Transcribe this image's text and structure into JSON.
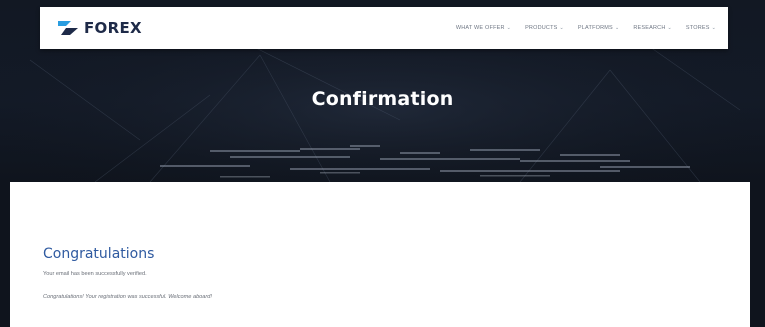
{
  "brand": {
    "name": "FOREX",
    "accent_color": "#2a9de0",
    "text_color": "#1e2a48"
  },
  "nav": {
    "items": [
      {
        "label": "WHAT WE OFFER",
        "icon": "chevron-down-icon"
      },
      {
        "label": "PRODUCTS",
        "icon": "chevron-down-icon"
      },
      {
        "label": "PLATFORMS",
        "icon": "chevron-down-icon"
      },
      {
        "label": "RESEARCH",
        "icon": "chevron-down-icon"
      },
      {
        "label": "STORES",
        "icon": "chevron-down-icon"
      }
    ]
  },
  "hero": {
    "title": "Confirmation"
  },
  "content": {
    "heading": "Congratulations",
    "line1": "Your email has been successfully verified.",
    "line2": "Congratulations! Your registration was successful. Welcome aboard!",
    "heading_color": "#2f5aa0"
  }
}
